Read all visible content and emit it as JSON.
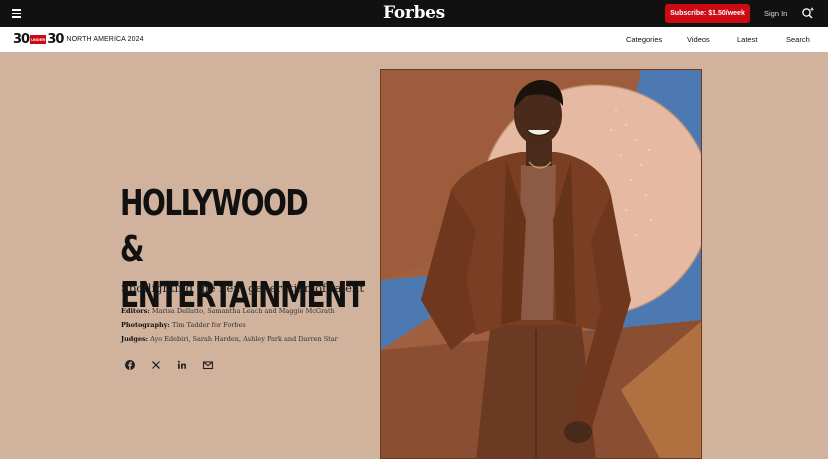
{
  "topbar": {
    "logo": "Forbes",
    "subscribe_label": "Subscribe: $1.50/week",
    "signin_label": "Sign In"
  },
  "subnav": {
    "brand_big_1": "30",
    "brand_under": "UNDER",
    "brand_big_2": "30",
    "brand_region": "NORTH AMERICA 2024",
    "links": [
      "Categories",
      "Videos",
      "Latest",
      "Search"
    ]
  },
  "hero": {
    "title_line1": "HOLLYWOOD &",
    "title_line2": "ENTERTAINMENT",
    "tagline": "Spotlighting the next generation of talent",
    "credits": [
      {
        "label": "Editors:",
        "value": " Marisa Dellatto, Samantha Leach and Maggie McGrath"
      },
      {
        "label": "Photography:",
        "value": " Tim Tadder for Forbes"
      },
      {
        "label": "Judges:",
        "value": " Ayo Edebiri, Sarah Harden, Ashley Park and Darren Star"
      }
    ]
  },
  "colors": {
    "page_bg": "#d1b29c",
    "topbar_bg": "#111111",
    "subscribe_bg": "#cc0a14",
    "photo_blue": "#4d79b2",
    "photo_peach": "#e6b9a2"
  },
  "icons": [
    "menu-icon",
    "search-icon",
    "facebook-icon",
    "x-icon",
    "linkedin-icon",
    "email-icon"
  ]
}
